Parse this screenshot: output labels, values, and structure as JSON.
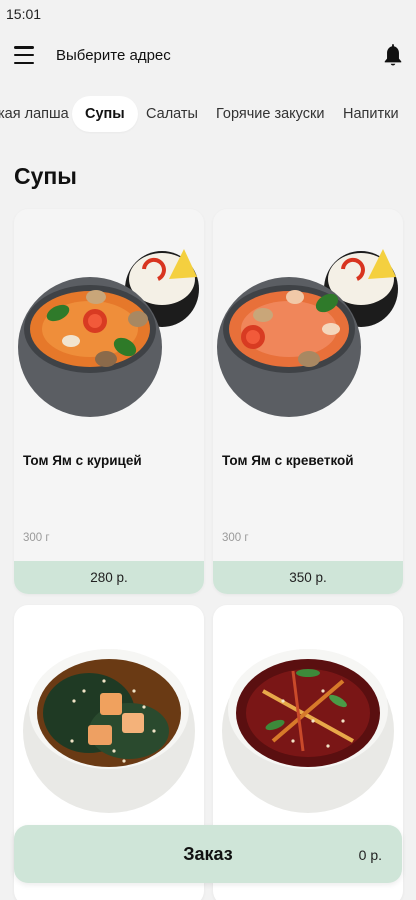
{
  "status": {
    "time": "15:01"
  },
  "header": {
    "address_label": "Выберите адрес"
  },
  "tabs": [
    {
      "label": "кая лапша"
    },
    {
      "label": "Супы"
    },
    {
      "label": "Салаты"
    },
    {
      "label": "Горячие закуски"
    },
    {
      "label": "Напитки"
    }
  ],
  "section": {
    "title": "Супы"
  },
  "products": [
    {
      "name": "Том Ям с курицей",
      "weight": "300 г",
      "price": "280 р."
    },
    {
      "name": "Том Ям с креветкой",
      "weight": "300 г",
      "price": "350 р."
    }
  ],
  "order": {
    "label": "Заказ",
    "total": "0 р."
  },
  "colors": {
    "accent": "#cfe5d8",
    "background": "#f2f2f2"
  }
}
